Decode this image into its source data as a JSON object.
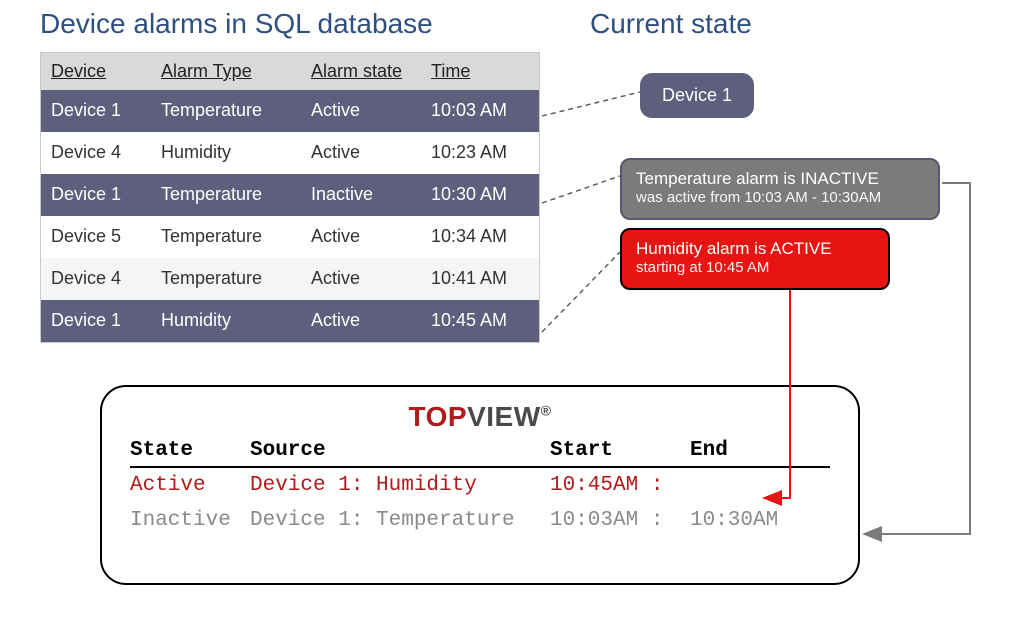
{
  "titles": {
    "left": "Device alarms in SQL database",
    "right": "Current state"
  },
  "sql_table": {
    "headers": {
      "device": "Device",
      "type": "Alarm Type",
      "state": "Alarm state",
      "time": "Time"
    },
    "rows": [
      {
        "device": "Device 1",
        "type": "Temperature",
        "state": "Active",
        "time": "10:03 AM",
        "hl": true
      },
      {
        "device": "Device 4",
        "type": "Humidity",
        "state": "Active",
        "time": "10:23 AM",
        "hl": false
      },
      {
        "device": "Device 1",
        "type": "Temperature",
        "state": "Inactive",
        "time": "10:30 AM",
        "hl": true
      },
      {
        "device": "Device 5",
        "type": "Temperature",
        "state": "Active",
        "time": "10:34 AM",
        "hl": false
      },
      {
        "device": "Device 4",
        "type": "Temperature",
        "state": "Active",
        "time": "10:41 AM",
        "hl": false
      },
      {
        "device": "Device 1",
        "type": "Humidity",
        "state": "Active",
        "time": "10:45 AM",
        "hl": true
      }
    ]
  },
  "current_state": {
    "device_chip": "Device 1",
    "temp": {
      "line1": "Temperature alarm is INACTIVE",
      "line2": "was active from 10:03 AM - 10:30AM"
    },
    "humidity": {
      "line1": "Humidity alarm is ACTIVE",
      "line2": "starting at 10:45 AM"
    }
  },
  "topview": {
    "logo": {
      "part1": "TOP",
      "part2": "VIEW",
      "reg": "®"
    },
    "headers": {
      "state": "State",
      "source": "Source",
      "start": "Start",
      "end": "End"
    },
    "rows": [
      {
        "state": "Active",
        "source": "Device 1: Humidity",
        "start": "10:45AM :",
        "end": "",
        "cls": "active"
      },
      {
        "state": "Inactive",
        "source": "Device 1: Temperature",
        "start": "10:03AM :",
        "end": "10:30AM",
        "cls": "inactive"
      }
    ]
  }
}
